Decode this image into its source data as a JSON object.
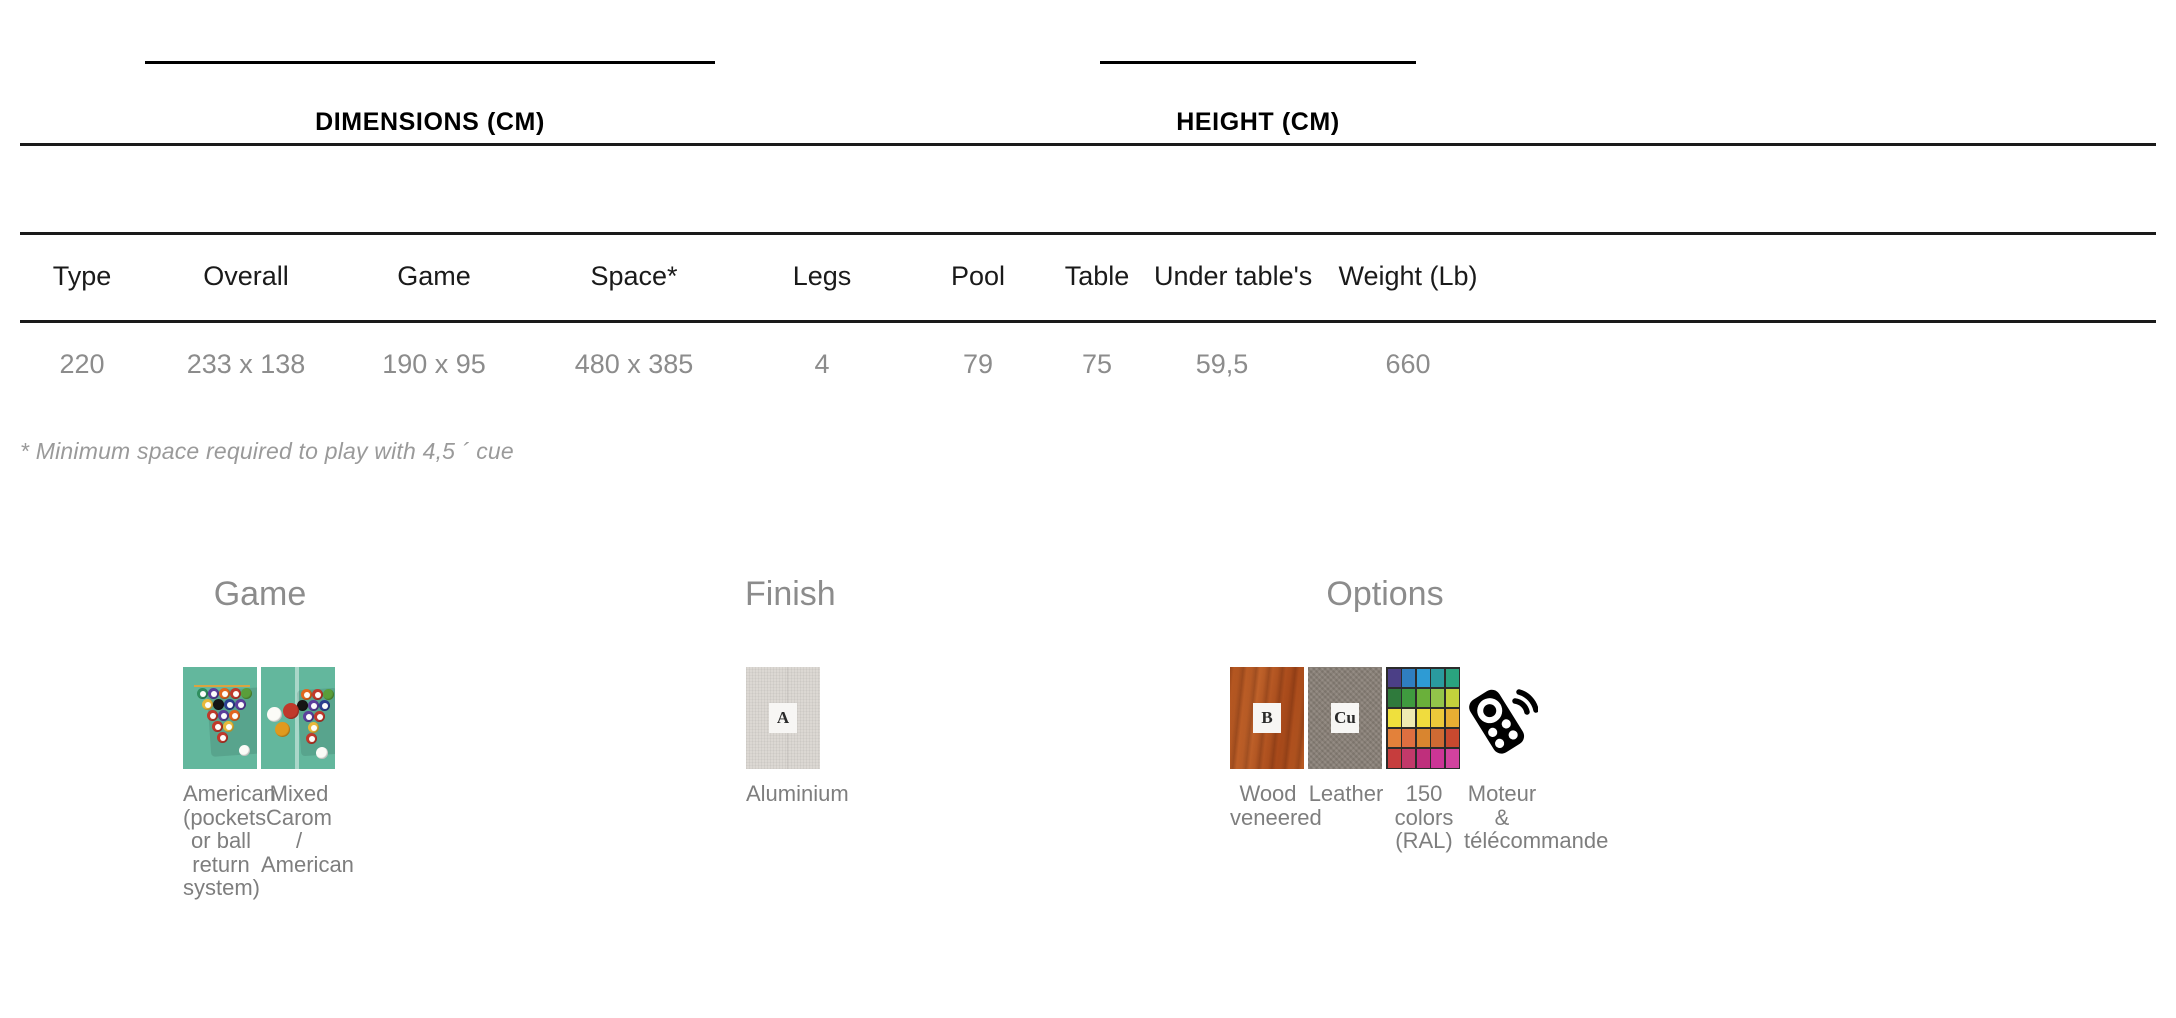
{
  "groups": [
    {
      "label": "DIMENSIONS (CM)"
    },
    {
      "label": "HEIGHT (CM)"
    }
  ],
  "table": {
    "headers": [
      "Type",
      "Overall",
      "Game",
      "Space*",
      "Legs",
      "Pool",
      "Table",
      "Under table's",
      "Weight (Lb)"
    ],
    "rows": [
      [
        "220",
        "233 x 138",
        "190 x 95",
        "480 x 385",
        "4",
        "79",
        "75",
        "59,5",
        "660"
      ]
    ]
  },
  "footnote": "* Minimum space required to play with 4,5 ´ cue",
  "sections": [
    {
      "title": "Game",
      "items": [
        {
          "label": "American (pockets or ball return system)",
          "icon": "pool-rack-thumbnail"
        },
        {
          "label": "Mixed Carom / American",
          "icon": "carom-american-thumbnail"
        }
      ]
    },
    {
      "title": "Finish",
      "items": [
        {
          "label": "Aluminium",
          "icon": "aluminium-swatch",
          "chip": "A"
        }
      ]
    },
    {
      "title": "Options",
      "items": [
        {
          "label": "Wood veneered",
          "icon": "wood-swatch",
          "chip": "B"
        },
        {
          "label": "Leather",
          "icon": "leather-swatch",
          "chip": "Cu"
        },
        {
          "label": "150 colors (RAL)",
          "icon": "ral-color-grid"
        },
        {
          "label": "Moteur & télécommande",
          "icon": "remote-control-icon"
        }
      ]
    }
  ],
  "colors": {
    "rule": "#1a1a1a",
    "header_text": "#1a1a1a",
    "data_text": "#8c8c8c",
    "section_title": "#8c8c8c",
    "label_text": "#7e7e7e",
    "footnote_text": "#9a9a9a",
    "felt_green": "#63b79d",
    "wood_brown": "#b2541f",
    "leather_gray": "#8a8178",
    "aluminium_gray": "#d8d4cf"
  },
  "ral_grid": [
    [
      "#4b3f86",
      "#2f7ec0",
      "#2e9bd4",
      "#2a9a9e",
      "#2aa37f"
    ],
    [
      "#2f7a3c",
      "#3f9a3f",
      "#6ab03a",
      "#93c44a",
      "#c3d13c"
    ],
    [
      "#efe03d",
      "#efeab2",
      "#f0dc3e",
      "#edc93a",
      "#e8ae33"
    ],
    [
      "#e3813a",
      "#de6f40",
      "#d9852f",
      "#cf6a33",
      "#c9492f"
    ],
    [
      "#c63d3d",
      "#c2396a",
      "#bf2f7c",
      "#cc3596",
      "#d1429e"
    ]
  ]
}
